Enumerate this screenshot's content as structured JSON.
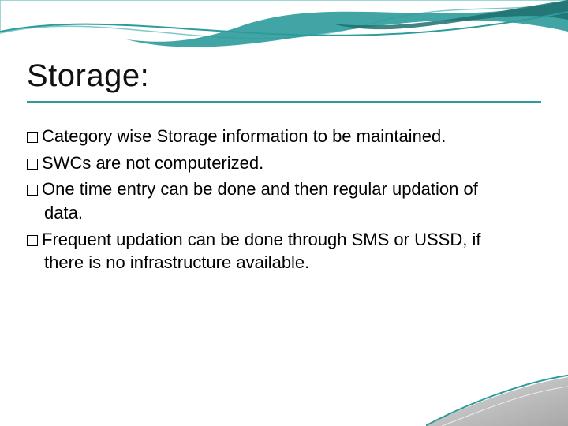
{
  "title": "Storage:",
  "bullets": [
    "Category wise Storage information to be maintained.",
    "SWCs are not computerized.",
    "One time entry can be done and then regular updation of data.",
    "Frequent updation can be done through SMS or USSD, if there is no infrastructure available."
  ],
  "accent_color": "#2E9B9B"
}
